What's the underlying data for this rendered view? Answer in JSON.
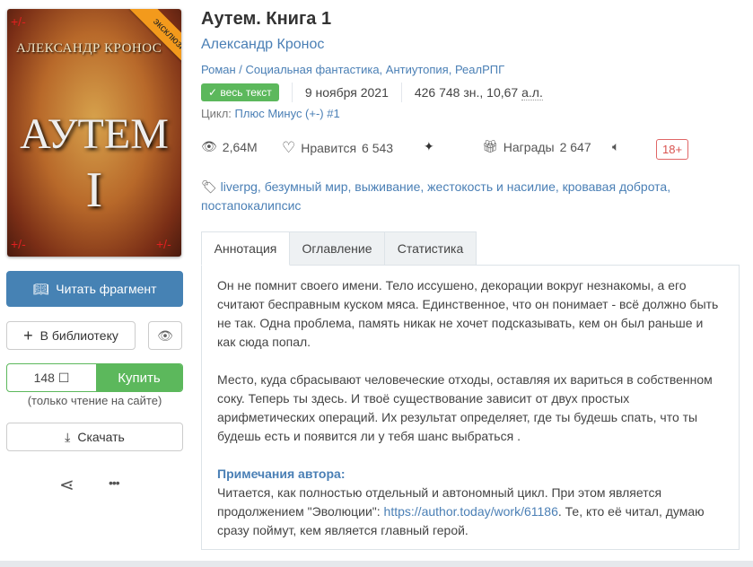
{
  "cover": {
    "author": "АЛЕКСАНДР КРОНОС",
    "title": "АУТЕМ",
    "number": "I",
    "ribbon": "эксклюзив",
    "marks": "+/-"
  },
  "book": {
    "title": "Аутем. Книга 1",
    "author": "Александр Кронос",
    "genre_prefix": "Роман / ",
    "genres": "Социальная фантастика, Антиутопия, РеалРПГ",
    "status_badge": "весь текст",
    "date": "9 ноября 2021",
    "size": "426 748 зн., 10,67 ",
    "size_unit": "а.л.",
    "cycle_label": "Цикл: ",
    "cycle": "Плюс Минус (+-) #1"
  },
  "stats": {
    "views": "2,64M",
    "likes_label": "Нравится",
    "likes": "6 543",
    "awards_label": "Награды",
    "awards": "2 647",
    "age": "18+"
  },
  "tags": [
    "liverpg",
    "безумный мир",
    "выживание",
    "жестокость и насилие",
    "кровавая доброта",
    "постапокалипсис"
  ],
  "actions": {
    "read": "Читать фрагмент",
    "library": "В библиотеку",
    "price": "148 ☐",
    "buy": "Купить",
    "buy_note": "(только чтение на сайте)",
    "download": "Скачать"
  },
  "tabs": [
    "Аннотация",
    "Оглавление",
    "Статистика"
  ],
  "annotation": {
    "p1": "Он не помнит своего имени. Тело иссушено, декорации вокруг незнакомы, а его считают бесправным куском мяса. Единственное, что он понимает - всё должно быть не так. Одна проблема, память никак не хочет подсказывать, кем он был раньше и как сюда попал.",
    "p2": "Место, куда сбрасывают человеческие отходы, оставляя их вариться в собственном соку. Теперь ты здесь. И твоё существование зависит от двух простых арифметических операций. Их результат определяет, где ты будешь спать, что ты будешь есть и появится ли у тебя шанс выбраться .",
    "notes_title": "Примечания автора:",
    "notes_a": "Читается, как полностью отдельный и автономный цикл. При этом является продолжением \"Эволюции\": ",
    "notes_link": "https://author.today/work/61186",
    "notes_b": ". Те, кто её читал, думаю сразу поймут, кем является главный герой."
  }
}
